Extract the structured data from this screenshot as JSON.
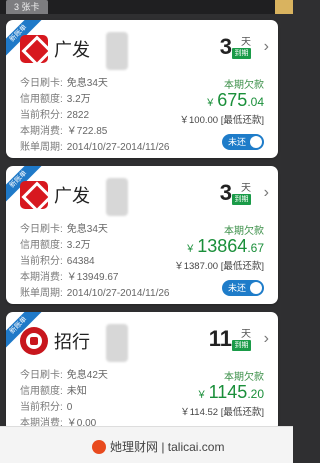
{
  "top_tab": "3 张卡",
  "cards": [
    {
      "ribbon": "新账单",
      "bank": "广发",
      "days": "3",
      "days_unit": "天",
      "due_tag": "到期",
      "rows": [
        {
          "label": "今日刷卡:",
          "value": "免息34天"
        },
        {
          "label": "信用额度:",
          "value": "3.2万"
        },
        {
          "label": "当前积分:",
          "value": "2822"
        },
        {
          "label": "本期消费:",
          "value": "￥722.85"
        },
        {
          "label": "账单周期:",
          "value": "2014/10/27-2014/11/26"
        }
      ],
      "due_label": "本期欠款",
      "currency": "￥",
      "amount_int": "675",
      "amount_dec": ".04",
      "min_pay": "￥100.00 [最低还款]",
      "toggle": "未还"
    },
    {
      "ribbon": "新账单",
      "bank": "广发",
      "days": "3",
      "days_unit": "天",
      "due_tag": "到期",
      "rows": [
        {
          "label": "今日刷卡:",
          "value": "免息34天"
        },
        {
          "label": "信用额度:",
          "value": "3.2万"
        },
        {
          "label": "当前积分:",
          "value": "64384"
        },
        {
          "label": "本期消费:",
          "value": "￥13949.67"
        },
        {
          "label": "账单周期:",
          "value": "2014/10/27-2014/11/26"
        }
      ],
      "due_label": "本期欠款",
      "currency": "￥",
      "amount_int": "13864",
      "amount_dec": ".67",
      "min_pay": "￥1387.00 [最低还款]",
      "toggle": "未还"
    },
    {
      "ribbon": "新账单",
      "bank": "招行",
      "days": "11",
      "days_unit": "天",
      "due_tag": "到期",
      "rows": [
        {
          "label": "今日刷卡:",
          "value": "免息42天"
        },
        {
          "label": "信用额度:",
          "value": "未知"
        },
        {
          "label": "当前积分:",
          "value": "0"
        },
        {
          "label": "本期消费:",
          "value": "￥0.00"
        }
      ],
      "due_label": "本期欠款",
      "currency": "￥",
      "amount_int": "1145",
      "amount_dec": ".20",
      "min_pay": "￥114.52 [最低还款]"
    }
  ],
  "watermark": "她理财网 | talicai.com",
  "colors": {
    "accent_blue": "#1e7cc9",
    "amount_green": "#1a8f3a",
    "gf_red": "#d7181f",
    "due_green": "#1a9b48"
  }
}
